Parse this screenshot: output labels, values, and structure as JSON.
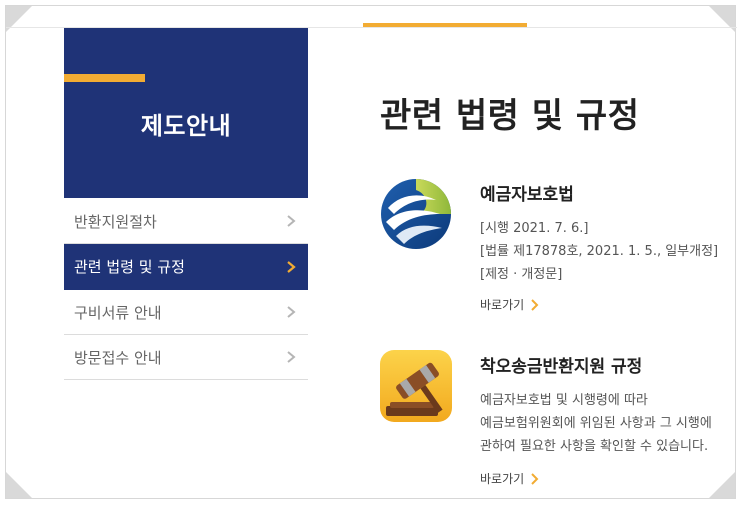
{
  "sidebar": {
    "title": "제도안내",
    "items": [
      {
        "label": "반환지원절차",
        "active": false
      },
      {
        "label": "관련 법령 및 규정",
        "active": true
      },
      {
        "label": "구비서류 안내",
        "active": false
      },
      {
        "label": "방문접수 안내",
        "active": false
      }
    ]
  },
  "main": {
    "title": "관련 법령 및 규정",
    "laws": [
      {
        "title": "예금자보호법",
        "lines": [
          "[시행 2021. 7. 6.]",
          "[법률 제17878호, 2021. 1. 5., 일부개정]",
          "[제정 · 개정문]"
        ],
        "link": "바로가기",
        "icon": "deposit-insurance-logo-icon"
      },
      {
        "title": "착오송금반환지원 규정",
        "lines": [
          "예금자보호법 및 시행령에 따라",
          "예금보험위원회에 위임된 사항과 그 시행에",
          "관하여 필요한 사항을 확인할 수 있습니다."
        ],
        "link": "바로가기",
        "icon": "gavel-icon"
      }
    ]
  },
  "colors": {
    "navy": "#1f3377",
    "accent": "#f2ac33"
  }
}
